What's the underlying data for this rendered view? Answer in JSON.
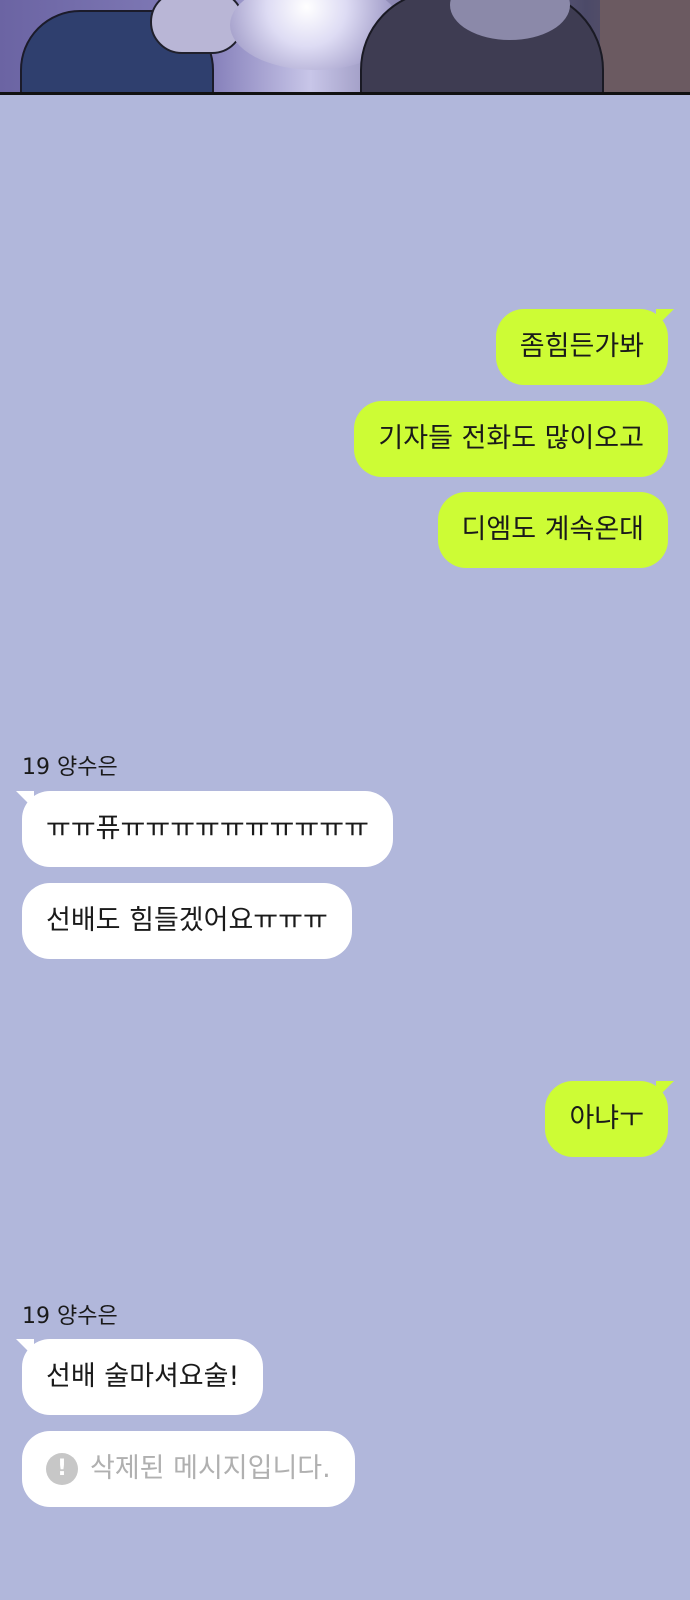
{
  "messages": [
    {
      "text": "좀힘든가봐"
    },
    {
      "text": "기자들 전화도 많이오고"
    },
    {
      "text": "디엠도 계속온대"
    },
    {
      "sender": "19 양수은"
    },
    {
      "text": "ㅠㅠ퓨ㅠㅠㅠㅠㅠㅠㅠㅠㅠㅠ"
    },
    {
      "text": "선배도 힘들겠어요ㅠㅠㅠ"
    },
    {
      "text": "아냐ㅜ"
    },
    {
      "sender": "19 양수은"
    },
    {
      "text": "선배 술마셔요술!"
    },
    {
      "text": "삭제된 메시지입니다.",
      "icon": "warning-circle-icon"
    }
  ],
  "colors": {
    "chat_background": "#b1b7db",
    "my_bubble": "#cdfc35",
    "their_bubble": "#ffffff",
    "deleted_text": "#b0b0b0"
  }
}
